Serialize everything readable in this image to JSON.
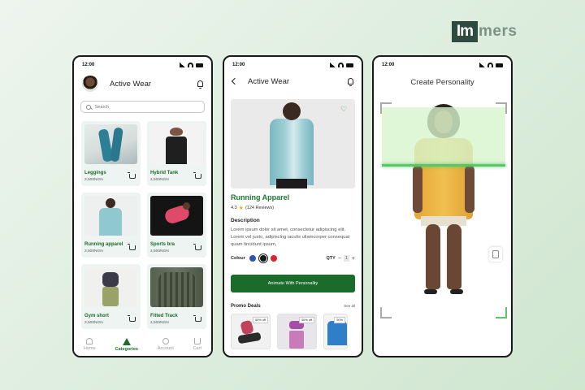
{
  "brand": {
    "logo_box": "Im",
    "logo_rest": "mers"
  },
  "status": {
    "time": "12:00"
  },
  "screen_categories": {
    "title": "Active Wear",
    "search_placeholder": "Search",
    "products": [
      {
        "name": "Leggings",
        "price": "2,500NGN"
      },
      {
        "name": "Hybrid Tank",
        "price": "2,500NGN"
      },
      {
        "name": "Running apparel",
        "price": "2,500NGN"
      },
      {
        "name": "Sports bra",
        "price": "2,500NGN"
      },
      {
        "name": "Gym short",
        "price": "2,500NGN"
      },
      {
        "name": "Fitted Track",
        "price": "2,500NGN"
      }
    ],
    "nav": [
      {
        "label": "Home",
        "icon": "home-icon",
        "active": false
      },
      {
        "label": "Categories",
        "icon": "categories-icon",
        "active": true
      },
      {
        "label": "Account",
        "icon": "account-icon",
        "active": false
      },
      {
        "label": "Cart",
        "icon": "cart-icon",
        "active": false
      }
    ]
  },
  "screen_product": {
    "title": "Active Wear",
    "product_name": "Running Apparel",
    "rating": "4.3",
    "reviews": "(124 Reviews)",
    "description_heading": "Description",
    "description": "Lorem ipsum dolor sit amet, consectetur adipiscing elit. Lorem vel justo, adipiscing iaculis ullamcorper consequat quam tincidunt ipsum,",
    "colour_label": "Colour",
    "colours": [
      "#2f53b5",
      "#0f1a14",
      "#d8262f"
    ],
    "qty_label": "QTY",
    "qty_value": "1",
    "cta_label": "Animate With Personality",
    "promo_heading": "Promo Deals",
    "see_all": "See all",
    "promos": [
      {
        "badge": "50% off"
      },
      {
        "badge": "50% off"
      },
      {
        "badge": "50%"
      }
    ]
  },
  "screen_personality": {
    "title": "Create Personality"
  },
  "colors": {
    "accent": "#1b6b2b",
    "scan": "#59c768"
  }
}
